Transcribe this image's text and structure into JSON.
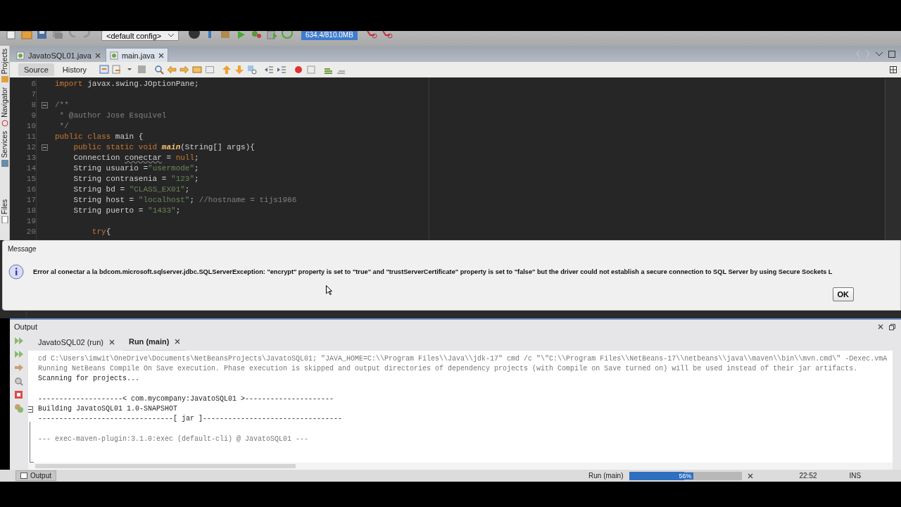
{
  "toolbar": {
    "config": "<default config>",
    "memory": "634.4/810.0MB"
  },
  "sidebar": {
    "items": [
      {
        "label": "Projects"
      },
      {
        "label": "Navigator"
      },
      {
        "label": "Services"
      },
      {
        "label": "Files"
      }
    ]
  },
  "editor_tabs": [
    {
      "label": "JavatoSQL01.java",
      "selected": false
    },
    {
      "label": "main.java",
      "selected": true
    }
  ],
  "view_tabs": [
    {
      "label": "Source",
      "selected": true
    },
    {
      "label": "History",
      "selected": false
    }
  ],
  "code": [
    {
      "number": "6",
      "fold": false,
      "segments": [
        {
          "kind": "keyword",
          "text": "import"
        },
        {
          "kind": "plain",
          "text": " javax.swing.JOptionPane;"
        }
      ]
    },
    {
      "number": "7",
      "fold": false
    },
    {
      "number": "8",
      "fold": true,
      "segments": [
        {
          "kind": "comment",
          "text": "/**"
        }
      ]
    },
    {
      "number": "9",
      "fold": false,
      "segments": [
        {
          "kind": "comment",
          "text": " * @author Jose Esquivel"
        }
      ]
    },
    {
      "number": "10",
      "fold": false,
      "segments": [
        {
          "kind": "comment",
          "text": " */"
        }
      ]
    },
    {
      "number": "11",
      "fold": false,
      "segments": [
        {
          "kind": "keyword",
          "text": "public class"
        },
        {
          "kind": "plain",
          "text": " main {"
        }
      ]
    },
    {
      "number": "12",
      "fold": true,
      "segments": [
        {
          "kind": "keyword",
          "text": "    public static void "
        },
        {
          "kind": "method",
          "text": "main"
        },
        {
          "kind": "plain",
          "text": "(String[] args){"
        }
      ]
    },
    {
      "number": "13",
      "fold": false,
      "segments": [
        {
          "kind": "plain",
          "text": "    Connection "
        },
        {
          "kind": "warning",
          "text": "conectar"
        },
        {
          "kind": "plain",
          "text": " = "
        },
        {
          "kind": "keyword",
          "text": "null"
        },
        {
          "kind": "plain",
          "text": ";"
        }
      ]
    },
    {
      "number": "14",
      "fold": false,
      "segments": [
        {
          "kind": "plain",
          "text": "    String usuario ="
        },
        {
          "kind": "string",
          "text": "\"usermode\""
        },
        {
          "kind": "plain",
          "text": ";"
        }
      ]
    },
    {
      "number": "15",
      "fold": false,
      "segments": [
        {
          "kind": "plain",
          "text": "    String contrasenia = "
        },
        {
          "kind": "string",
          "text": "\"123\""
        },
        {
          "kind": "plain",
          "text": ";"
        }
      ]
    },
    {
      "number": "16",
      "fold": false,
      "segments": [
        {
          "kind": "plain",
          "text": "    String bd = "
        },
        {
          "kind": "string",
          "text": "\"CLASS_EX01\""
        },
        {
          "kind": "plain",
          "text": ";"
        }
      ]
    },
    {
      "number": "17",
      "fold": false,
      "segments": [
        {
          "kind": "plain",
          "text": "    String host = "
        },
        {
          "kind": "string",
          "text": "\"localhost\""
        },
        {
          "kind": "plain",
          "text": "; "
        },
        {
          "kind": "comment",
          "text": "//hostname = tijs1986"
        }
      ]
    },
    {
      "number": "18",
      "fold": false,
      "segments": [
        {
          "kind": "plain",
          "text": "    String puerto = "
        },
        {
          "kind": "string",
          "text": "\"1433\""
        },
        {
          "kind": "plain",
          "text": ";"
        }
      ]
    },
    {
      "number": "19",
      "fold": false
    },
    {
      "number": "20",
      "fold": false,
      "segments": [
        {
          "kind": "keyword",
          "text": "        try"
        },
        {
          "kind": "plain",
          "text": "{"
        }
      ]
    }
  ],
  "dialog": {
    "title": "Message",
    "message": "Error al conectar a la bdcom.microsoft.sqlserver.jdbc.SQLServerException: \"encrypt\" property is set to \"true\" and \"trustServerCertificate\" property is set to \"false\" but the driver could not establish a secure connection to SQL Server by using Secure Sockets L",
    "button": "OK"
  },
  "output": {
    "title": "Output",
    "tabs": [
      {
        "label": "JavatoSQL02 (run)",
        "selected": false
      },
      {
        "label": "Run (main)",
        "selected": true
      }
    ],
    "lines": [
      {
        "kind": "info",
        "fold": false,
        "text": "cd C:\\Users\\imwit\\OneDrive\\Documents\\NetBeansProjects\\JavatoSQL01; \"JAVA_HOME=C:\\\\Program Files\\\\Java\\\\jdk-17\" cmd /c \"\\\"C:\\\\Program Files\\\\NetBeans-17\\\\netbeans\\\\java\\\\maven\\\\bin\\\\mvn.cmd\\\" -Dexec.vmA"
      },
      {
        "kind": "info",
        "fold": false,
        "text": "Running NetBeans Compile On Save execution. Phase execution is skipped and output directories of dependency projects (with Compile on Save turned on) will be used instead of their jar artifacts."
      },
      {
        "kind": "normal",
        "fold": false,
        "text": "Scanning for projects..."
      },
      {
        "kind": "blank",
        "fold": false
      },
      {
        "kind": "normal",
        "fold": false,
        "text": "--------------------< com.mycompany:JavatoSQL01 >---------------------"
      },
      {
        "kind": "normal",
        "fold": true,
        "text": "Building JavatoSQL01 1.0-SNAPSHOT"
      },
      {
        "kind": "normal",
        "fold": false,
        "text": "--------------------------------[ jar ]---------------------------------"
      },
      {
        "kind": "blank",
        "fold": false
      },
      {
        "kind": "info",
        "fold": false,
        "text": "--- exec-maven-plugin:3.1.0:exec (default-cli) @ JavatoSQL01 ---"
      }
    ]
  },
  "status": {
    "tab": "Output",
    "task": "Run (main)",
    "progress": {
      "level": 0.49,
      "reading": "56%"
    },
    "time": "22:52",
    "mode": "INS"
  }
}
